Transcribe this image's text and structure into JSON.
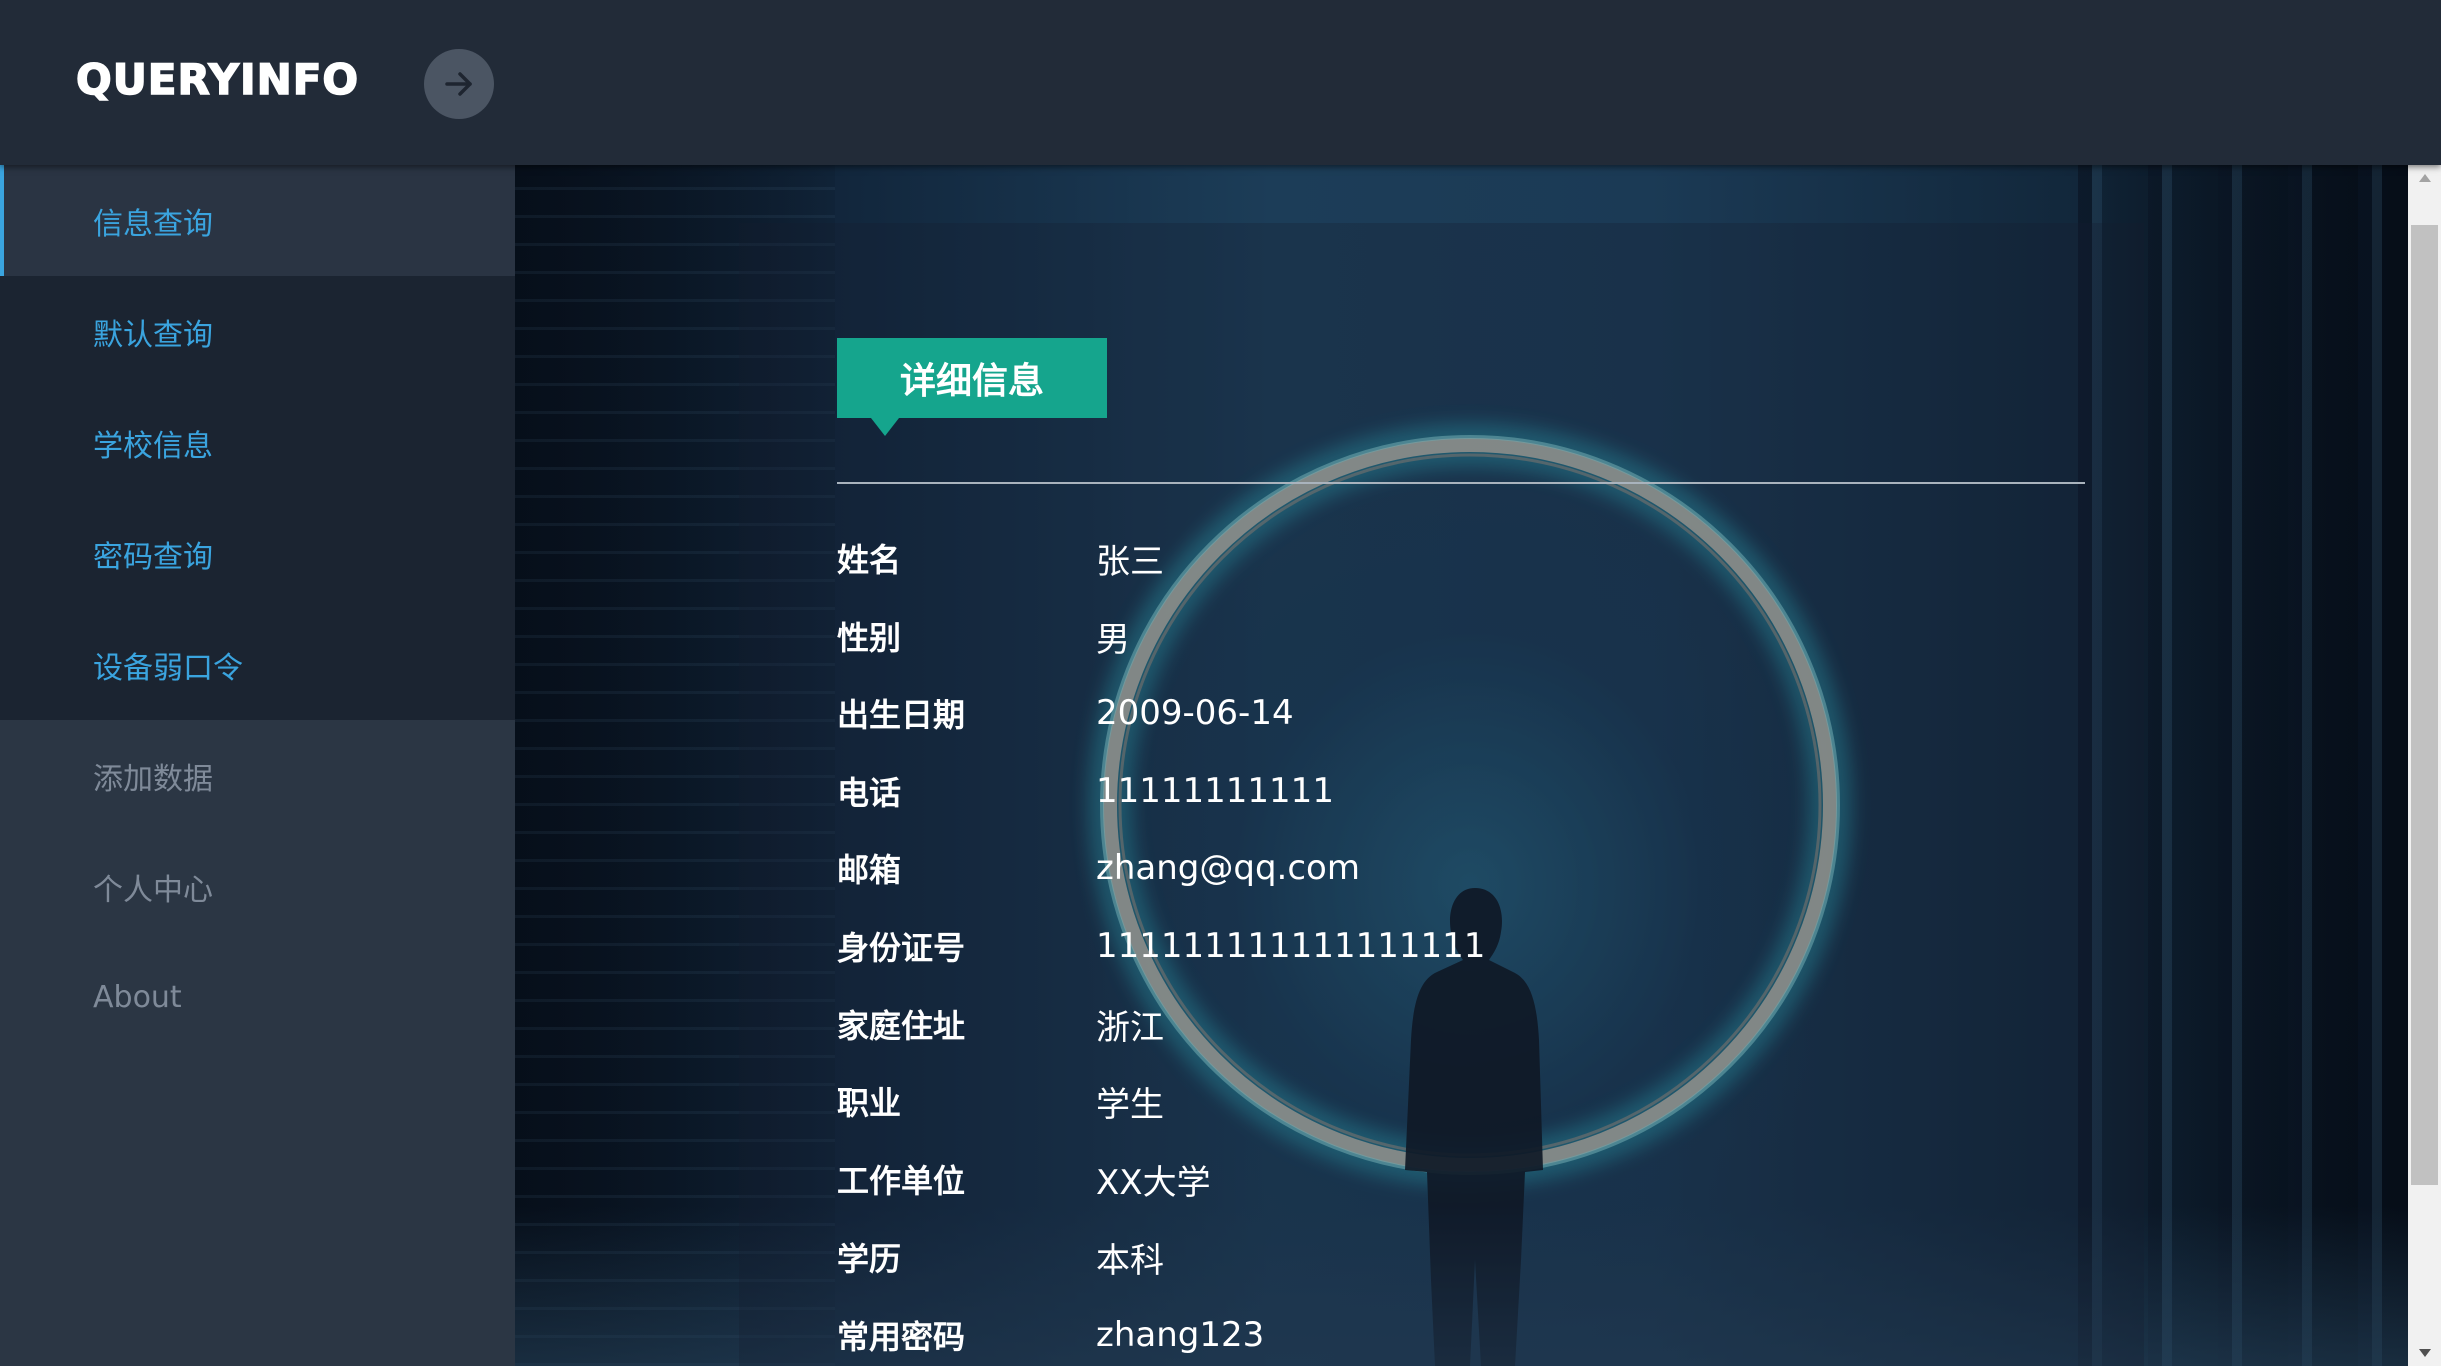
{
  "header": {
    "logo_text": "QUERYINFO",
    "toggle_icon": "arrow-right-icon"
  },
  "sidebar": {
    "items": [
      {
        "label": "信息查询",
        "active": true
      },
      {
        "label": "默认查询"
      },
      {
        "label": "学校信息"
      },
      {
        "label": "密码查询"
      },
      {
        "label": "设备弱口令"
      },
      {
        "label": "添加数据"
      },
      {
        "label": "个人中心"
      },
      {
        "label": "About"
      }
    ]
  },
  "main": {
    "section_title": "详细信息",
    "details": [
      {
        "label": "姓名",
        "value": "张三"
      },
      {
        "label": "性别",
        "value": "男"
      },
      {
        "label": "出生日期",
        "value": "2009-06-14"
      },
      {
        "label": "电话",
        "value": "11111111111"
      },
      {
        "label": "邮箱",
        "value": "zhang@qq.com"
      },
      {
        "label": "身份证号",
        "value": "111111111111111111"
      },
      {
        "label": "家庭住址",
        "value": "浙江"
      },
      {
        "label": "职业",
        "value": "学生"
      },
      {
        "label": "工作单位",
        "value": "XX大学"
      },
      {
        "label": "学历",
        "value": "本科"
      },
      {
        "label": "常用密码",
        "value": "zhang123"
      }
    ]
  },
  "colors": {
    "accent_blue": "#3aa4df",
    "tag_green": "#15a58d",
    "header_bg": "#222b38",
    "sidebar_bg": "#2b3644",
    "submenu_bg": "#1b2431"
  }
}
